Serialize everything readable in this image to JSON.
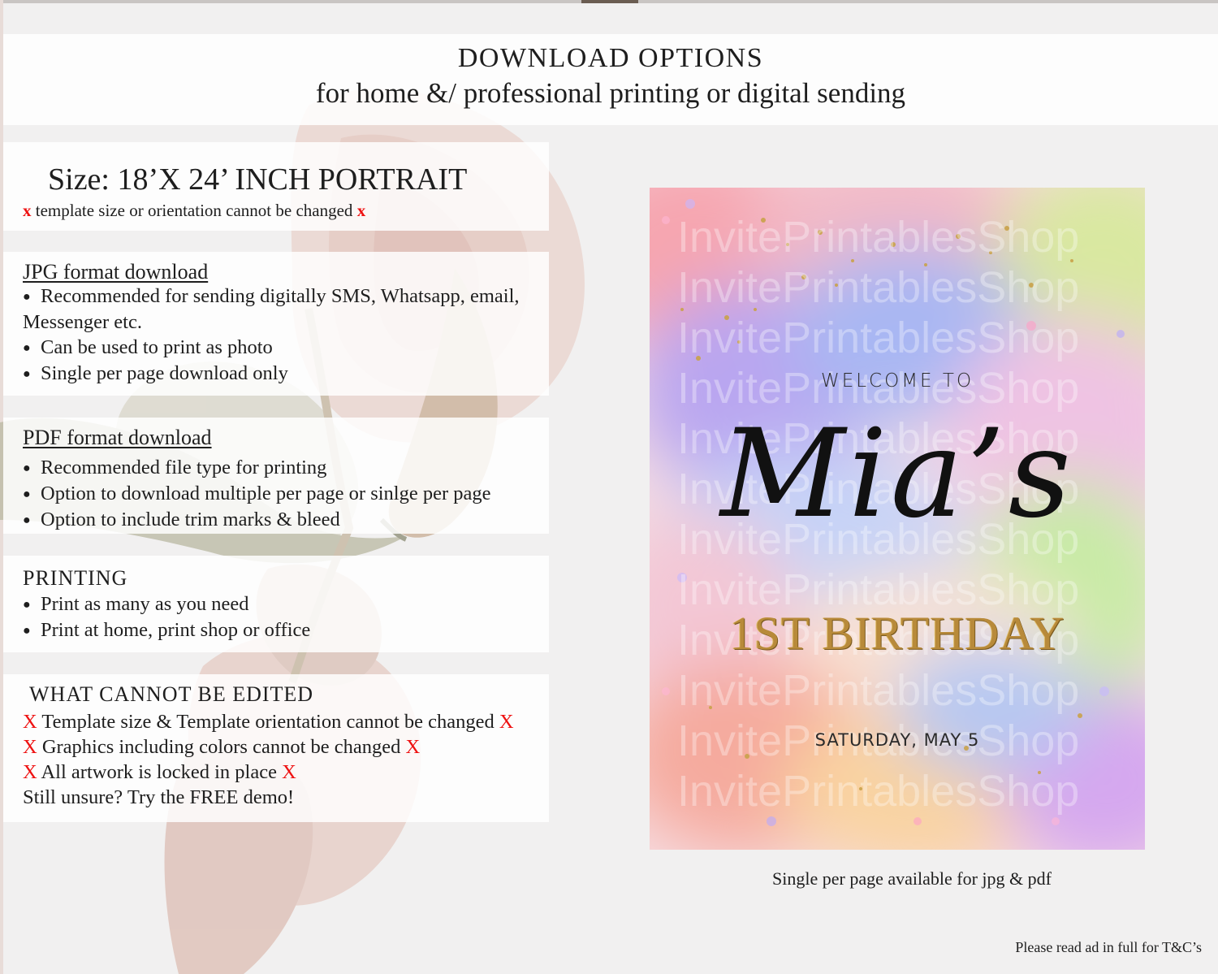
{
  "header": {
    "title": "DOWNLOAD OPTIONS",
    "subtitle": "for home &/ professional printing or digital sending"
  },
  "size_panel": {
    "title": "Size: 18’X 24’ INCH PORTRAIT",
    "note_mark": "x",
    "note": "template size or orientation cannot be changed"
  },
  "jpg_panel": {
    "title": "JPG format download",
    "bullets": [
      "Recommended for sending digitally SMS, Whatsapp, email,",
      "Can be used to print as photo",
      "Single per page download only"
    ],
    "bullet_continuation": "Messenger etc."
  },
  "pdf_panel": {
    "title": "PDF format download",
    "bullets": [
      "Recommended file type for printing",
      "Option to download multiple per page or sinlge per page",
      "Option to include trim marks & bleed"
    ]
  },
  "printing_panel": {
    "title": "PRINTING",
    "bullets": [
      "Print as many as you need",
      "Print at home, print shop or office"
    ]
  },
  "edit_panel": {
    "title": "WHAT CANNOT BE EDITED",
    "mark": "X",
    "lines": [
      "Template size & Template orientation cannot be changed",
      "Graphics including colors cannot be changed",
      "All artwork is locked in place"
    ],
    "closing": "Still unsure? Try the FREE demo!"
  },
  "card": {
    "welcome": "WELCOME TO",
    "name": "Mia’s",
    "event": "1ST BIRTHDAY",
    "date": "SATURDAY, MAY 5",
    "watermark": "InvitePrintablesShop"
  },
  "caption": "Single per page available for jpg & pdf",
  "footnote": "Please read ad in full for T&C’s",
  "colors": {
    "mark_red": "#e11111",
    "gold": "#b88a3a",
    "text": "#1e1e1e",
    "flower": "#e7cbc3"
  },
  "icons": {
    "bullet": "bullet-dot-icon",
    "cross": "red-x-icon",
    "background": "tulip-flowers-image"
  }
}
